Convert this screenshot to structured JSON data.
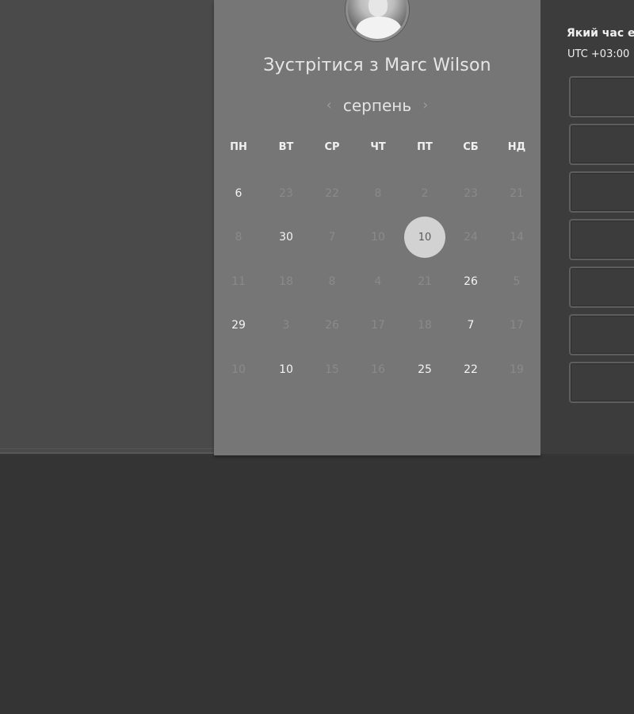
{
  "scheduler": {
    "title": "Зустрітися з Marc Wilson",
    "month": "серпень",
    "prev_icon": "chevron-left-icon",
    "next_icon": "chevron-right-icon",
    "weekdays": [
      "ПН",
      "ВТ",
      "СР",
      "ЧТ",
      "ПТ",
      "СБ",
      "НД"
    ],
    "weeks": [
      [
        {
          "d": "6",
          "s": "active"
        },
        {
          "d": "23",
          "s": "muted"
        },
        {
          "d": "22",
          "s": "muted"
        },
        {
          "d": "8",
          "s": "muted"
        },
        {
          "d": "2",
          "s": "muted"
        },
        {
          "d": "23",
          "s": "muted"
        },
        {
          "d": "21",
          "s": "muted"
        }
      ],
      [
        {
          "d": "8",
          "s": "muted"
        },
        {
          "d": "30",
          "s": "active"
        },
        {
          "d": "7",
          "s": "muted"
        },
        {
          "d": "10",
          "s": "muted"
        },
        {
          "d": "10",
          "s": "selected"
        },
        {
          "d": "24",
          "s": "muted"
        },
        {
          "d": "14",
          "s": "muted"
        }
      ],
      [
        {
          "d": "11",
          "s": "muted"
        },
        {
          "d": "18",
          "s": "muted"
        },
        {
          "d": "8",
          "s": "muted"
        },
        {
          "d": "4",
          "s": "muted"
        },
        {
          "d": "21",
          "s": "muted"
        },
        {
          "d": "26",
          "s": "active"
        },
        {
          "d": "5",
          "s": "muted"
        }
      ],
      [
        {
          "d": "29",
          "s": "active"
        },
        {
          "d": "3",
          "s": "muted"
        },
        {
          "d": "26",
          "s": "muted"
        },
        {
          "d": "17",
          "s": "muted"
        },
        {
          "d": "18",
          "s": "muted"
        },
        {
          "d": "7",
          "s": "active"
        },
        {
          "d": "17",
          "s": "muted"
        }
      ],
      [
        {
          "d": "10",
          "s": "muted"
        },
        {
          "d": "10",
          "s": "active"
        },
        {
          "d": "15",
          "s": "muted"
        },
        {
          "d": "16",
          "s": "muted"
        },
        {
          "d": "25",
          "s": "active"
        },
        {
          "d": "22",
          "s": "active"
        },
        {
          "d": "19",
          "s": "muted"
        }
      ]
    ]
  },
  "timezone": {
    "question": "Який час е",
    "value": "UTC +03:00"
  },
  "time_slots_count": 7,
  "colors": {
    "page_bg": "#363636",
    "left_pane": "#4a4a4a",
    "scheduler_bg": "#767676",
    "selected_day": "#d2d2d2",
    "right_pane": "#3c3c3c"
  }
}
